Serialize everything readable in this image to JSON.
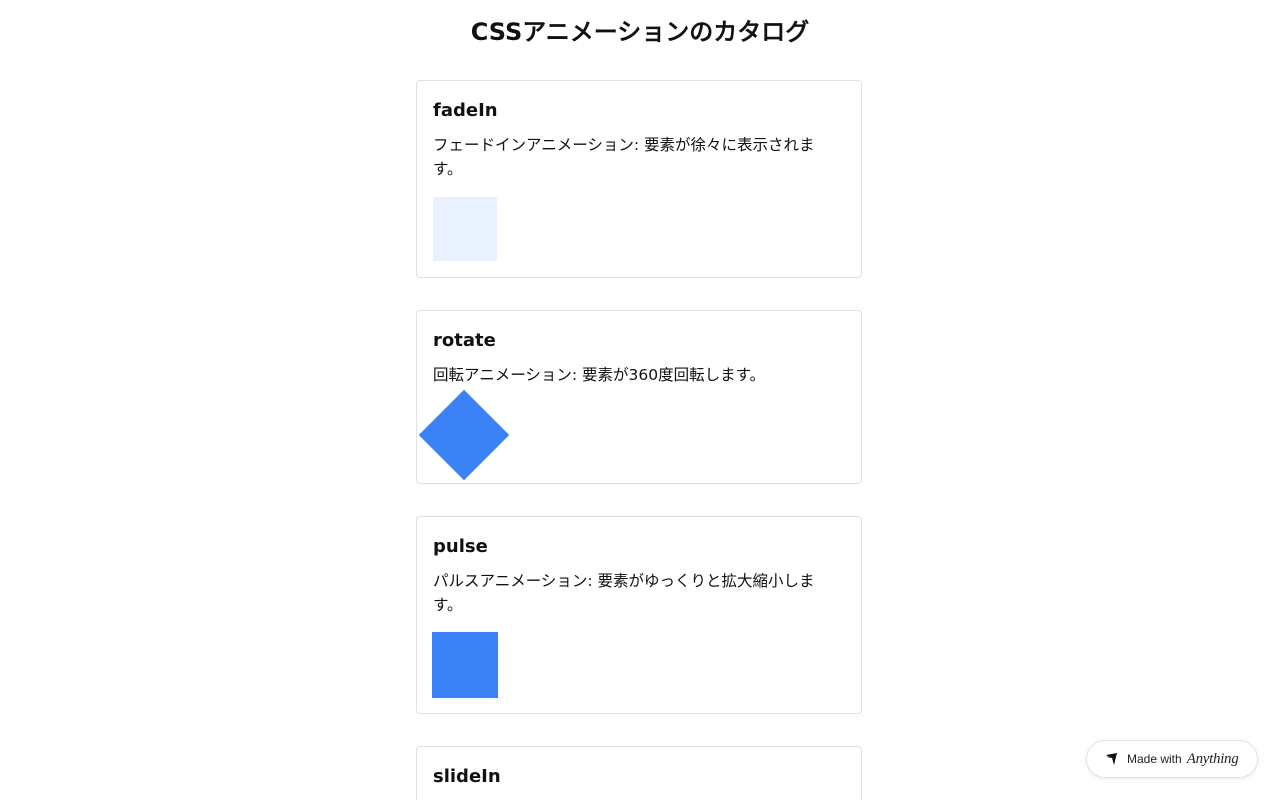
{
  "page": {
    "title": "CSSアニメーションのカタログ"
  },
  "colors": {
    "accent": "#3b82f6",
    "border": "#e0e0e0"
  },
  "cards": [
    {
      "name": "fadeIn",
      "description": "フェードインアニメーション: 要素が徐々に表示されます。",
      "demo": "faded-square",
      "opacity": 0.11
    },
    {
      "name": "rotate",
      "description": "回転アニメーション: 要素が360度回転します。",
      "demo": "rotated-square",
      "rotation_deg": 45
    },
    {
      "name": "pulse",
      "description": "パルスアニメーション: 要素がゆっくりと拡大縮小します。",
      "demo": "square"
    },
    {
      "name": "slideIn",
      "description": ""
    }
  ],
  "badge": {
    "prefix": "Made with",
    "brand": "Anything",
    "icon": "anything-logo-icon"
  }
}
